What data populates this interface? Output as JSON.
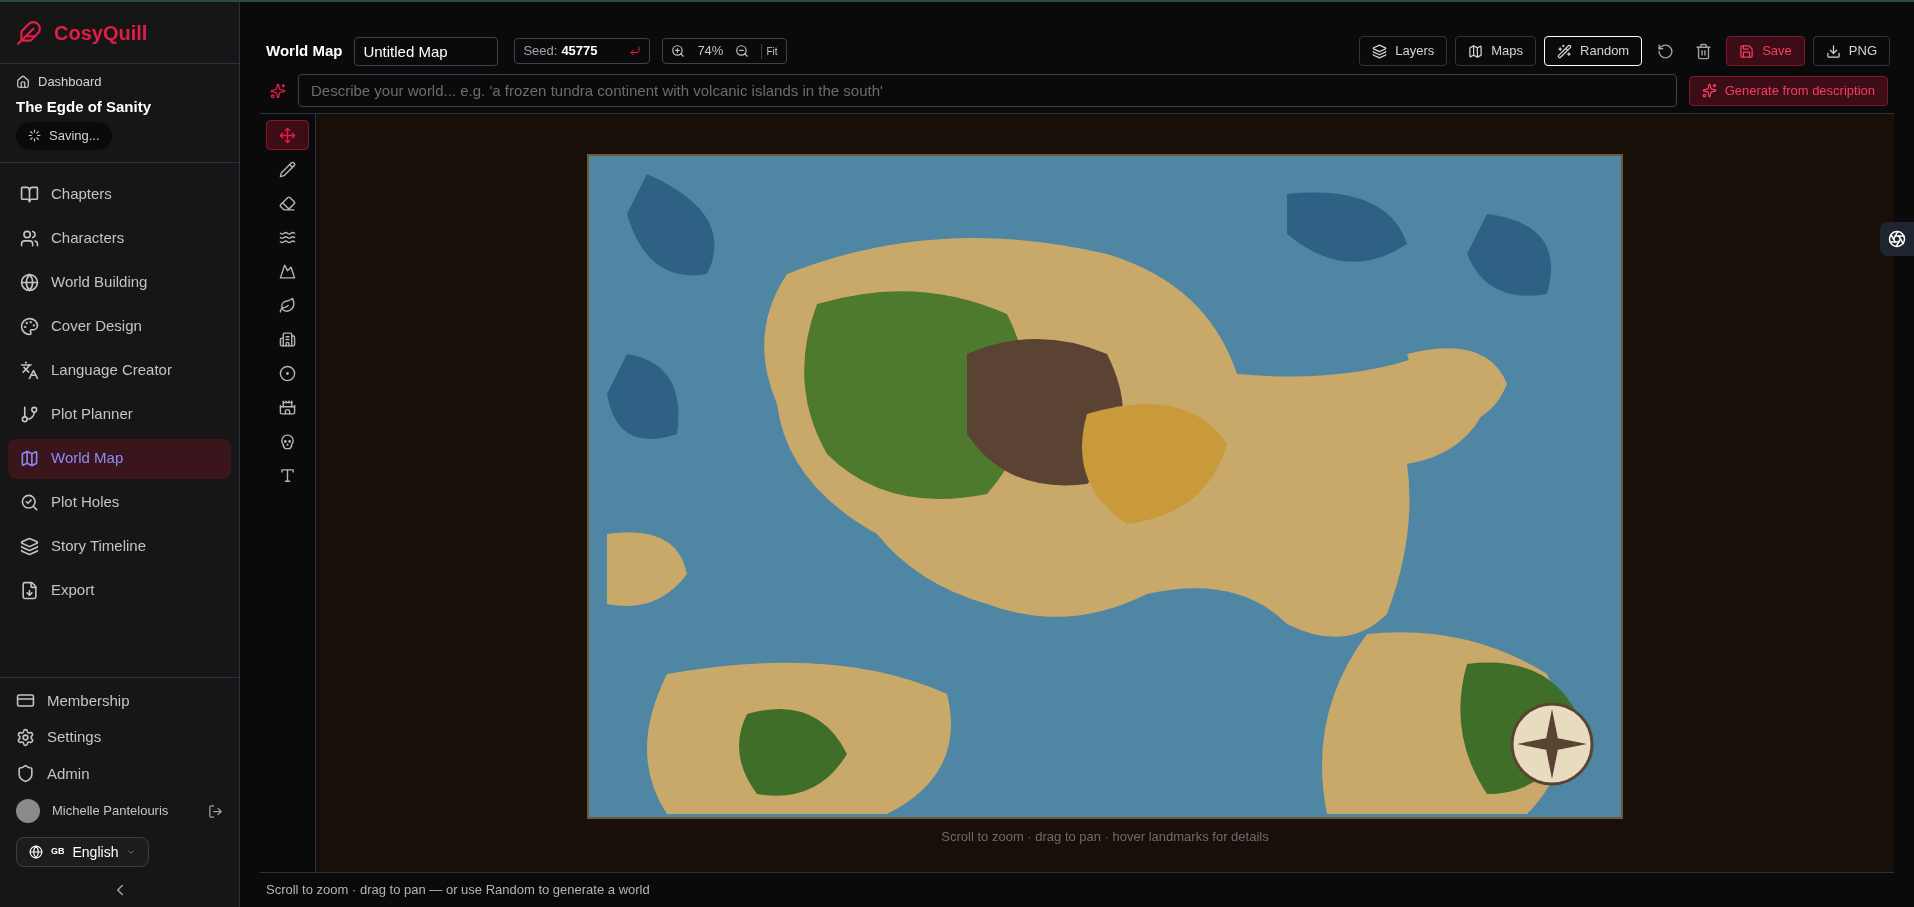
{
  "brand": {
    "name": "CosyQuill"
  },
  "project": {
    "breadcrumb": "Dashboard",
    "title": "The Egde of Sanity",
    "status": "Saving..."
  },
  "nav": [
    {
      "label": "Chapters",
      "selected": false
    },
    {
      "label": "Characters",
      "selected": false
    },
    {
      "label": "World Building",
      "selected": false
    },
    {
      "label": "Cover Design",
      "selected": false
    },
    {
      "label": "Language Creator",
      "selected": false
    },
    {
      "label": "Plot Planner",
      "selected": false
    },
    {
      "label": "World Map",
      "selected": true
    },
    {
      "label": "Plot Holes",
      "selected": false
    },
    {
      "label": "Story Timeline",
      "selected": false
    },
    {
      "label": "Export",
      "selected": false
    }
  ],
  "footer_nav": [
    {
      "label": "Membership"
    },
    {
      "label": "Settings"
    },
    {
      "label": "Admin"
    }
  ],
  "user": {
    "name": "Michelle Pantelouris"
  },
  "language": {
    "flag": "GB",
    "label": "English"
  },
  "header": {
    "title": "World Map",
    "map_name": "Untitled Map",
    "seed_label": "Seed:",
    "seed_value": "45775",
    "zoom": "74%",
    "fit": "Fit"
  },
  "actions": [
    {
      "label": "Layers",
      "kind": "plain"
    },
    {
      "label": "Maps",
      "kind": "plain"
    },
    {
      "label": "Random",
      "kind": "outlined"
    },
    {
      "kind": "icon"
    },
    {
      "kind": "icon"
    },
    {
      "label": "Save",
      "kind": "danger"
    },
    {
      "label": "PNG",
      "kind": "plain"
    }
  ],
  "prompt": {
    "placeholder": "Describe your world... e.g. 'a frozen tundra continent with volcanic islands in the south'",
    "button": "Generate from description"
  },
  "tools": [
    {
      "selected": true
    },
    {
      "selected": false
    },
    {
      "selected": false
    },
    {
      "selected": false
    },
    {
      "selected": false
    },
    {
      "selected": false
    },
    {
      "selected": false
    },
    {
      "selected": false
    },
    {
      "selected": false
    },
    {
      "selected": false
    },
    {
      "selected": false
    }
  ],
  "canvas": {
    "hint": "Scroll to zoom · drag to pan · hover landmarks for details"
  },
  "status_bar": "Scroll to zoom · drag to pan — or use Random to generate a world"
}
